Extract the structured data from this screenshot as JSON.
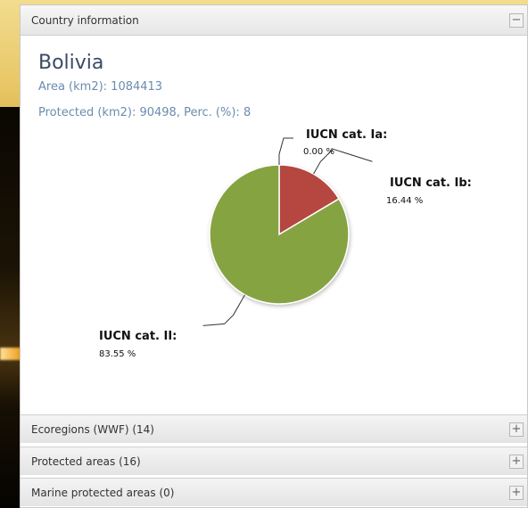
{
  "panel": {
    "title": "Country information",
    "collapse_symbol": "−",
    "expand_symbol": "+"
  },
  "country": {
    "name": "Bolivia",
    "area_line": "Area (km2): 1084413",
    "protected_line": "Protected (km2): 90498, Perc. (%): 8"
  },
  "chart_data": {
    "type": "pie",
    "slices": [
      {
        "label": "IUCN cat. Ia",
        "value_text": "0.00 %",
        "value": 0.0,
        "color": "#cfcfcf"
      },
      {
        "label": "IUCN cat. Ib",
        "value_text": "16.44 %",
        "value": 16.44,
        "color": "#b5473f"
      },
      {
        "label": "IUCN cat. II",
        "value_text": "83.55 %",
        "value": 83.55,
        "color": "#86a343"
      }
    ]
  },
  "accordion": [
    {
      "label": "Ecoregions (WWF) (14)",
      "icon": "+"
    },
    {
      "label": "Protected areas (16)",
      "icon": "+"
    },
    {
      "label": "Marine protected areas (0)",
      "icon": "+"
    }
  ],
  "colors": {
    "label_colon": "#3d6ea8",
    "panel_header": "#e6e6e6",
    "pie_border": "#ffffff"
  }
}
